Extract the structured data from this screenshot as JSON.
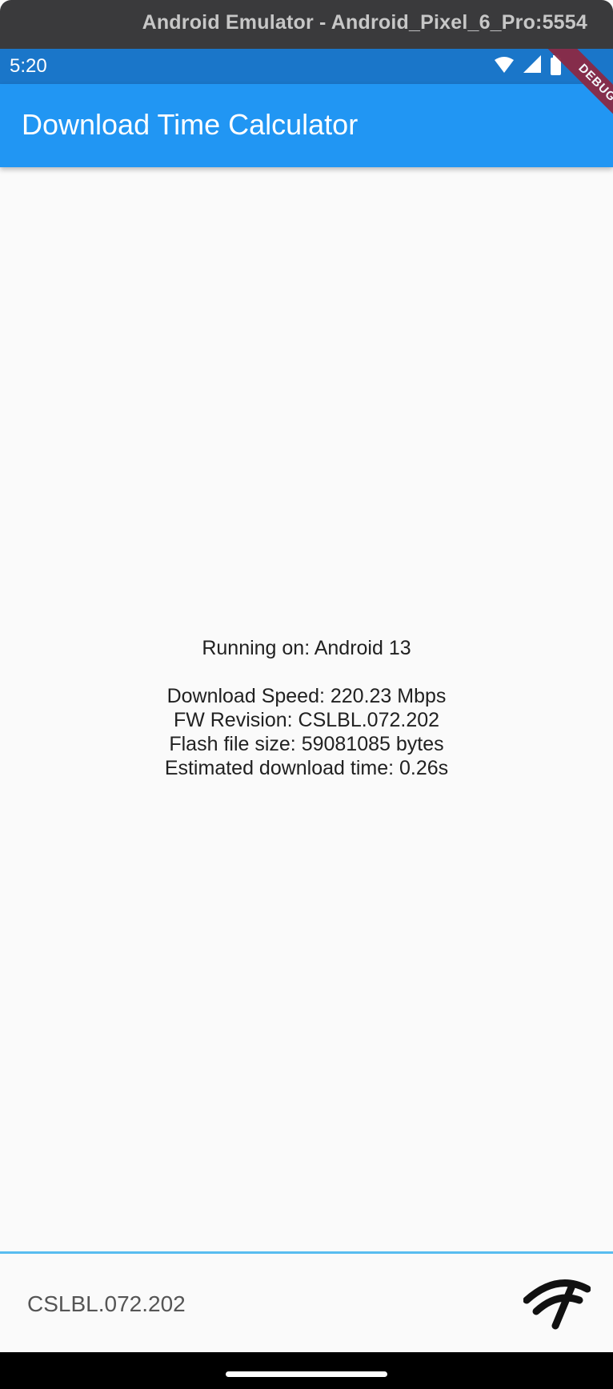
{
  "emulator": {
    "title": "Android Emulator - Android_Pixel_6_Pro:5554"
  },
  "status_bar": {
    "time": "5:20"
  },
  "debug_banner": {
    "label": "DEBUG"
  },
  "app_bar": {
    "title": "Download Time Calculator"
  },
  "info": {
    "running_on": "Running on: Android 13",
    "download_speed": "Download Speed: 220.23 Mbps",
    "fw_revision": "FW Revision: CSLBL.072.202",
    "flash_file_size": "Flash file size: 59081085 bytes",
    "estimated_time": "Estimated download time: 0.26s"
  },
  "bottom_bar": {
    "fw_value": "CSLBL.072.202",
    "icon": "network-speed-icon"
  },
  "colors": {
    "app_bar": "#2196f3",
    "status_bar": "#1a76c9",
    "divider": "#58bdf0",
    "debug_ribbon": "#8b2a45"
  }
}
